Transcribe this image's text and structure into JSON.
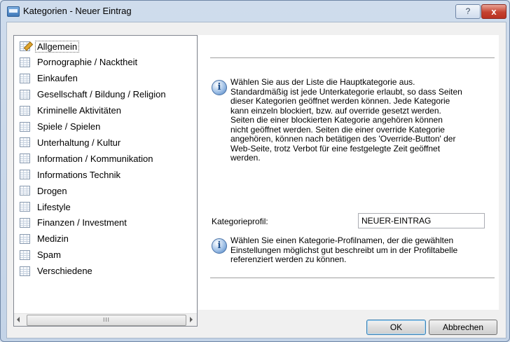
{
  "window": {
    "title": "Kategorien - Neuer Eintrag",
    "help_label": "?",
    "close_label": "x"
  },
  "tree": {
    "items": [
      {
        "label": "Allgemein",
        "selected": true
      },
      {
        "label": "Pornographie / Nacktheit"
      },
      {
        "label": "Einkaufen"
      },
      {
        "label": "Gesellschaft / Bildung / Religion"
      },
      {
        "label": "Kriminelle Aktivitäten"
      },
      {
        "label": "Spiele / Spielen"
      },
      {
        "label": "Unterhaltung / Kultur"
      },
      {
        "label": "Information / Kommunikation"
      },
      {
        "label": "Informations Technik"
      },
      {
        "label": "Drogen"
      },
      {
        "label": "Lifestyle"
      },
      {
        "label": "Finanzen / Investment"
      },
      {
        "label": "Medizin"
      },
      {
        "label": "Spam"
      },
      {
        "label": "Verschiedene"
      }
    ],
    "scroll_thumb_grip": "III"
  },
  "panel": {
    "info1": [
      "Wählen Sie aus der Liste die Hauptkategorie aus.",
      "Standardmäßig ist jede Unterkategorie erlaubt, so dass Seiten",
      "dieser Kategorien geöffnet werden können. Jede Kategorie",
      "kann einzeln blockiert, bzw. auf override gesetzt werden.",
      "Seiten die einer blockierten Kategorie angehören können",
      "nicht geöffnet werden. Seiten die einer override Kategorie",
      "angehören, können nach betätigen des 'Override-Button' der",
      "Web-Seite, trotz Verbot für eine festgelegte Zeit geöffnet",
      "werden."
    ],
    "profile_label": "Kategorieprofil:",
    "profile_value": "NEUER-EINTRAG",
    "info2": [
      "Wählen Sie einen Kategorie-Profilnamen, der die gewählten",
      "Einstellungen möglichst gut beschreibt um in der Profiltabelle",
      "referenziert werden zu können."
    ]
  },
  "buttons": {
    "ok": "OK",
    "cancel": "Abbrechen"
  }
}
